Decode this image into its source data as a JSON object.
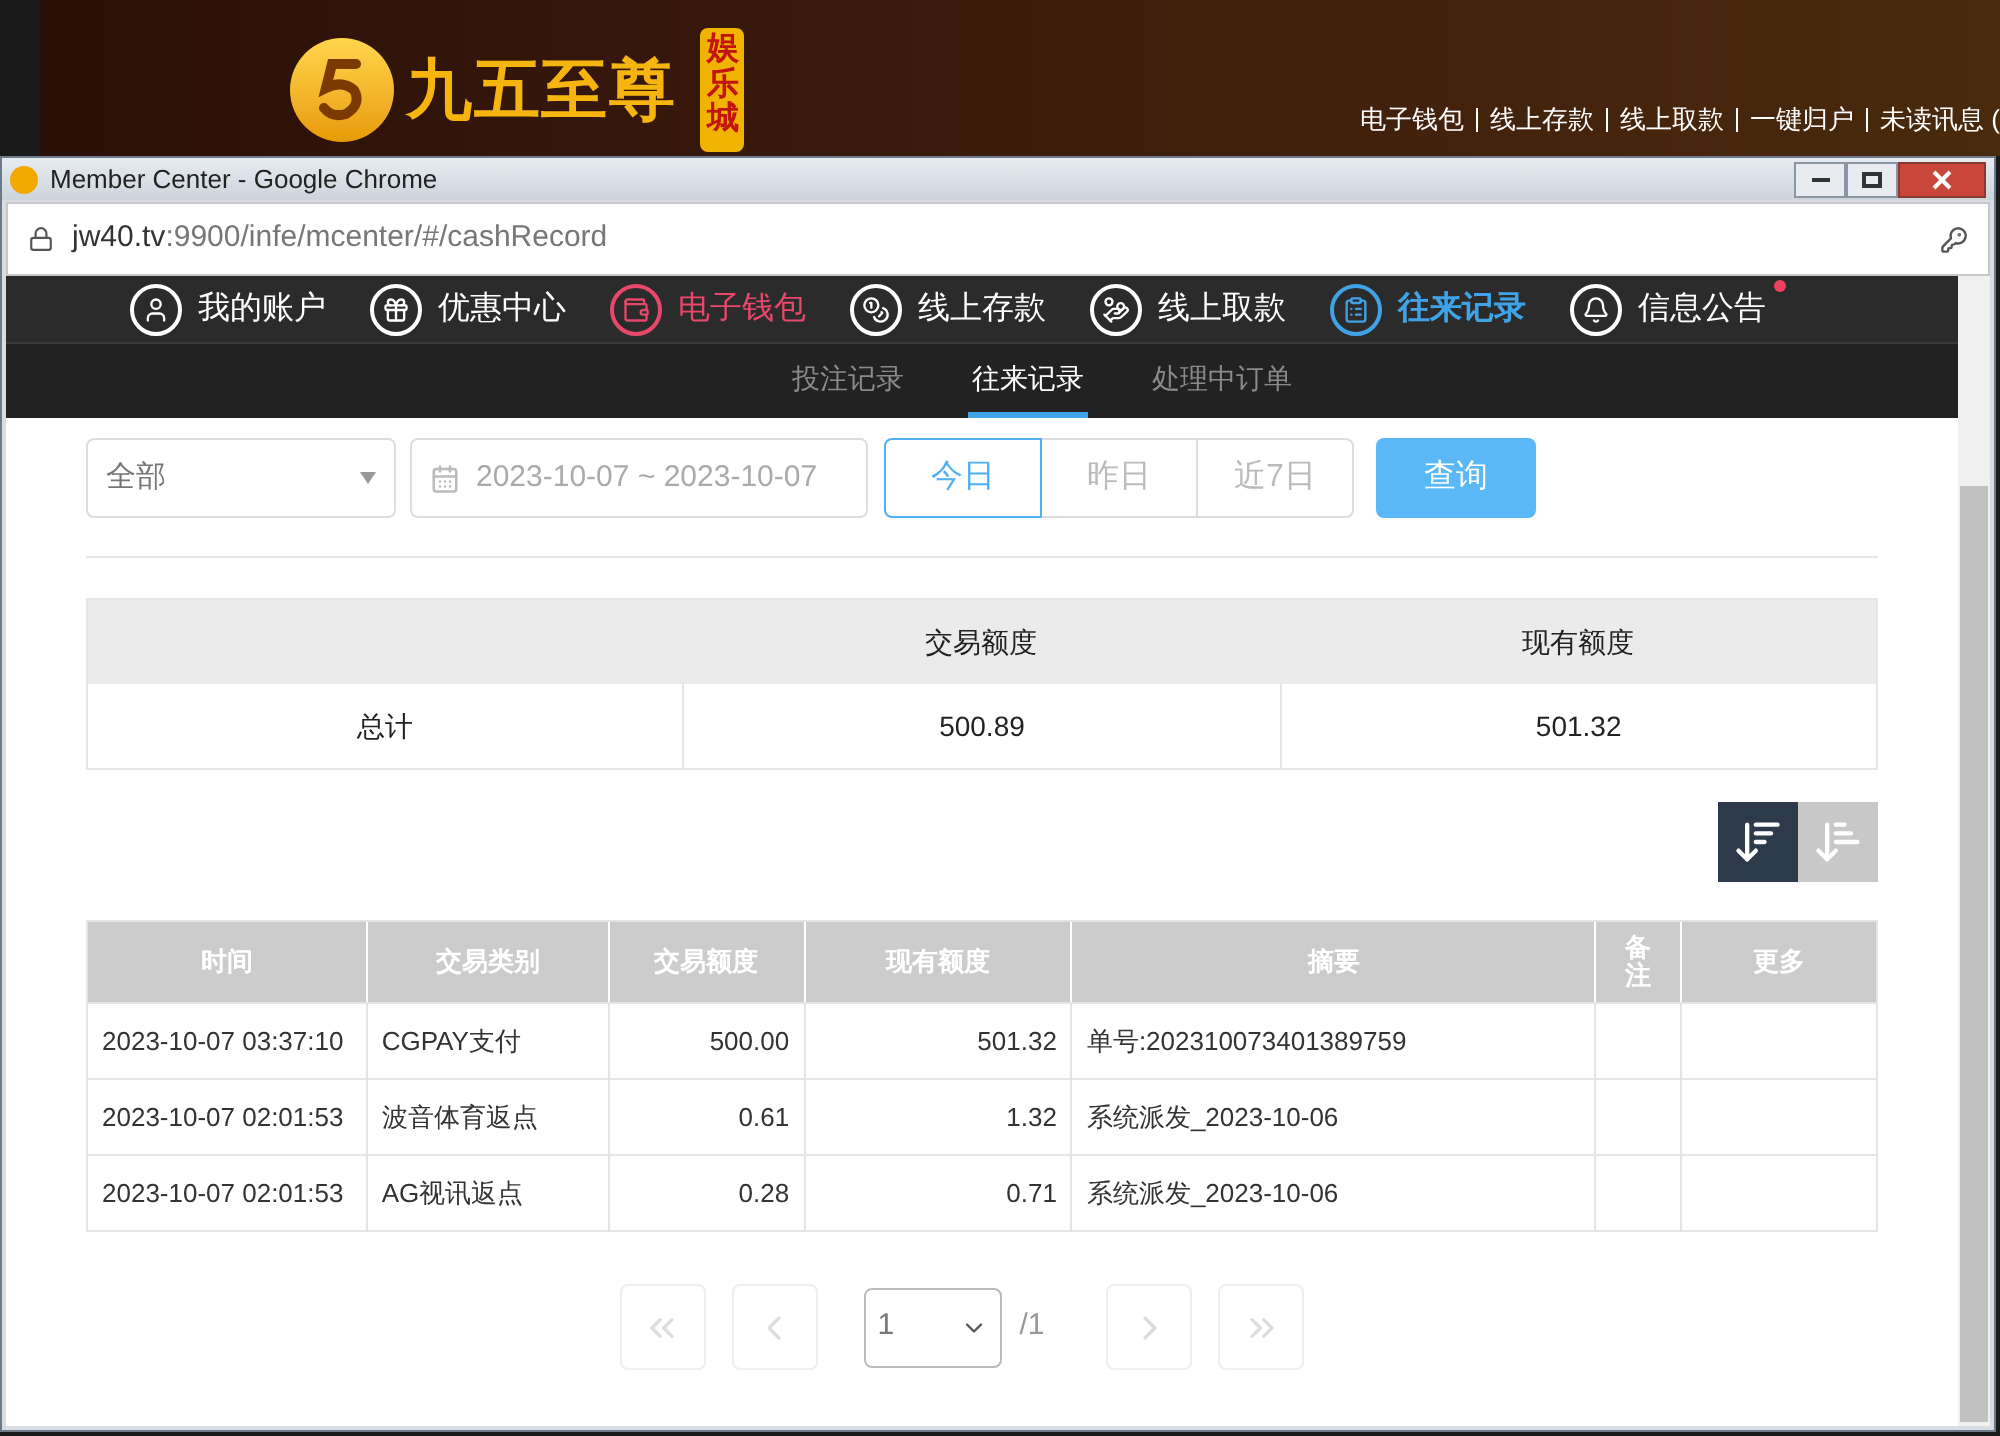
{
  "site_header": {
    "logo_text": "九五至尊",
    "logo_tag": "娱乐城",
    "links": [
      "电子钱包",
      "线上存款",
      "线上取款",
      "一键归户",
      "未读讯息 ("
    ]
  },
  "window": {
    "title": "Member Center - Google Chrome",
    "url_host": "jw40.tv",
    "url_rest": ":9900/infe/mcenter/#/cashRecord"
  },
  "nav": [
    {
      "label": "我的账户",
      "color": "#ffffff",
      "selected": false,
      "badge": false
    },
    {
      "label": "优惠中心",
      "color": "#ffffff",
      "selected": false,
      "badge": false
    },
    {
      "label": "电子钱包",
      "color": "#e8476a",
      "selected": false,
      "badge": false
    },
    {
      "label": "线上存款",
      "color": "#ffffff",
      "selected": false,
      "badge": false
    },
    {
      "label": "线上取款",
      "color": "#ffffff",
      "selected": false,
      "badge": false
    },
    {
      "label": "往来记录",
      "color": "#3fa3e8",
      "selected": true,
      "badge": false
    },
    {
      "label": "信息公告",
      "color": "#ffffff",
      "selected": false,
      "badge": true
    }
  ],
  "subtabs": [
    {
      "label": "投注记录",
      "selected": false
    },
    {
      "label": "往来记录",
      "selected": true
    },
    {
      "label": "处理中订单",
      "selected": false
    }
  ],
  "filters": {
    "type_select": "全部",
    "date_range": "2023-10-07 ~ 2023-10-07",
    "ranges": [
      {
        "label": "今日",
        "selected": true
      },
      {
        "label": "昨日",
        "selected": false
      },
      {
        "label": "近7日",
        "selected": false
      }
    ],
    "query_button": "查询"
  },
  "summary": {
    "columns": [
      "交易额度",
      "现有额度"
    ],
    "row": [
      "总计",
      "500.89",
      "501.32"
    ]
  },
  "sort_buttons": [
    {
      "kind": "desc",
      "selected": true
    },
    {
      "kind": "asc",
      "selected": false
    }
  ],
  "table": {
    "columns": [
      "时间",
      "交易类别",
      "交易额度",
      "现有额度",
      "摘要",
      "备注",
      "更多"
    ],
    "rows": [
      [
        "2023-10-07 03:37:10",
        "CGPAY支付",
        "500.00",
        "501.32",
        "单号:202310073401389759",
        "",
        ""
      ],
      [
        "2023-10-07 02:01:53",
        "波音体育返点",
        "0.61",
        "1.32",
        "系统派发_2023-10-06",
        "",
        ""
      ],
      [
        "2023-10-07 02:01:53",
        "AG视讯返点",
        "0.28",
        "0.71",
        "系统派发_2023-10-06",
        "",
        ""
      ]
    ]
  },
  "pagination": {
    "page": "1",
    "total": "/1"
  }
}
